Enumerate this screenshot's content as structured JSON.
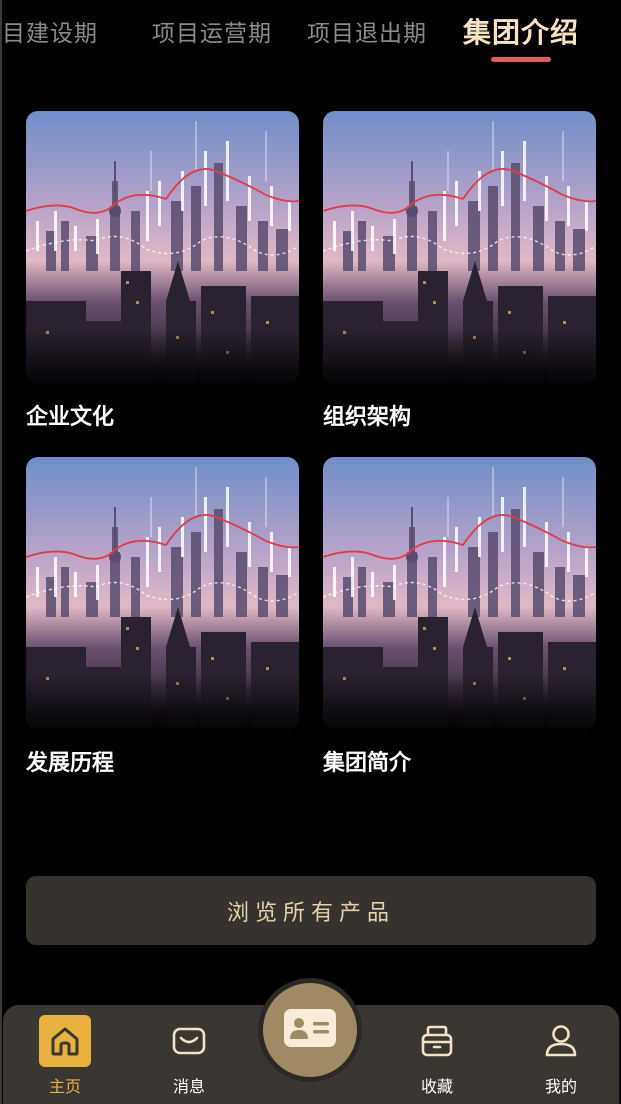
{
  "tabs": [
    {
      "label": "目建设期",
      "active": false
    },
    {
      "label": "项目运营期",
      "active": false
    },
    {
      "label": "项目退出期",
      "active": false
    },
    {
      "label": "集团介绍",
      "active": true
    }
  ],
  "cards": [
    {
      "label": "企业文化",
      "image": "city-skyline-stock-chart-image"
    },
    {
      "label": "组织架构",
      "image": "city-skyline-stock-chart-image"
    },
    {
      "label": "发展历程",
      "image": "city-skyline-stock-chart-image"
    },
    {
      "label": "集团简介",
      "image": "city-skyline-stock-chart-image"
    }
  ],
  "browse_button": {
    "label": "浏览所有产品"
  },
  "bottom_nav": {
    "items": [
      {
        "label": "主页",
        "icon": "home-icon",
        "active": true
      },
      {
        "label": "消息",
        "icon": "message-icon",
        "active": false
      },
      {
        "label": "",
        "icon": "id-card-icon",
        "active": false
      },
      {
        "label": "收藏",
        "icon": "archive-box-icon",
        "active": false
      },
      {
        "label": "我的",
        "icon": "user-icon",
        "active": false
      }
    ]
  },
  "colors": {
    "background": "#000000",
    "active_tab_text": "#f6e3c4",
    "active_tab_underline": "#e65a5a",
    "accent_gold": "#e9b23f",
    "button_bg": "#36332e",
    "button_text": "#e5d2b0",
    "nav_bg": "#3a3631",
    "center_button": "#a08a64"
  }
}
